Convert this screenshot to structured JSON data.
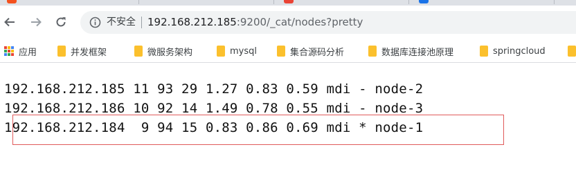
{
  "colors": {
    "highlight_border": "#e05a5a",
    "folder": "#fbc02d"
  },
  "toolbar": {
    "back_icon": "back-arrow-icon",
    "forward_icon": "forward-arrow-icon",
    "reload_icon": "reload-icon",
    "security_label": "不安全",
    "url_host": "192.168.212.185",
    "url_rest": ":9200/_cat/nodes?pretty"
  },
  "bookmarks": [
    {
      "label": "应用",
      "icon": "apps-grid-icon"
    },
    {
      "label": "并发框架",
      "icon": "folder-icon"
    },
    {
      "label": "微服务架构",
      "icon": "folder-icon"
    },
    {
      "label": "mysql",
      "icon": "folder-icon"
    },
    {
      "label": "集合源码分析",
      "icon": "folder-icon"
    },
    {
      "label": "数据库连接池原理",
      "icon": "folder-icon"
    },
    {
      "label": "springcloud",
      "icon": "folder-icon"
    }
  ],
  "nodes": [
    "192.168.212.185 11 93 29 1.27 0.83 0.59 mdi - node-2",
    "192.168.212.186 10 92 14 1.49 0.78 0.55 mdi - node-3",
    "192.168.212.184  9 94 15 0.83 0.86 0.69 mdi * node-1"
  ]
}
